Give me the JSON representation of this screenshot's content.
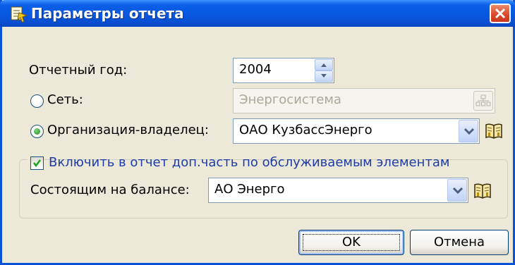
{
  "window": {
    "title": "Параметры отчета",
    "icon": "report-settings-icon"
  },
  "form": {
    "year_label": "Отчетный год:",
    "year_value": "2004",
    "network": {
      "label": "Сеть:",
      "selected": false,
      "value": "Энергосистема",
      "enabled": false
    },
    "owner": {
      "label": "Организация-владелец:",
      "selected": true,
      "value": "ОАО КузбассЭнерго"
    },
    "include_checkbox": {
      "label": "Включить в отчет доп.часть по обслуживаемым элементам",
      "checked": true
    },
    "balance": {
      "label": "Состоящим на балансе:",
      "value": "АО Энерго"
    }
  },
  "buttons": {
    "ok": "OK",
    "cancel": "Отмена"
  },
  "colors": {
    "titlebar": "#0758e0",
    "dialog_bg": "#ece9d8",
    "link_text": "#1e3ba8",
    "close_button": "#d9452a"
  }
}
